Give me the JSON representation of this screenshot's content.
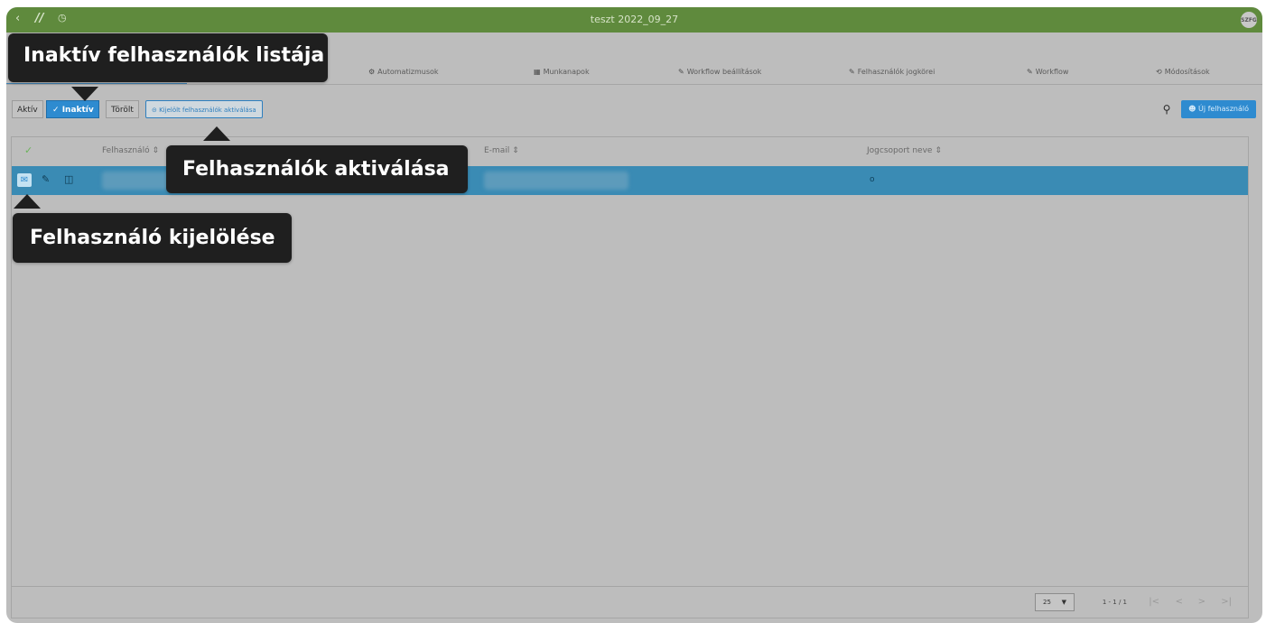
{
  "topbar": {
    "title": "teszt 2022_09_27",
    "avatar": "SZFG",
    "back_icon": "chevron-left-icon",
    "logo_icon": "app-logo-icon",
    "history_icon": "clock-icon"
  },
  "tabs": [
    {
      "label": "Automatizmusok",
      "icon": "cog-icon"
    },
    {
      "label": "Munkanapok",
      "icon": "calendar-icon"
    },
    {
      "label": "Workflow beállítások",
      "icon": "pencil-icon"
    },
    {
      "label": "Felhasználók jogkörei",
      "icon": "pencil-icon"
    },
    {
      "label": "Workflow",
      "icon": "pencil-icon"
    },
    {
      "label": "Módosítások",
      "icon": "history-icon"
    }
  ],
  "filters": {
    "aktiv": "Aktív",
    "inaktiv": "Inaktív",
    "torolt": "Törölt",
    "activate_selected": "Kijelölt felhasználók aktiválása"
  },
  "toolbar": {
    "new_user": "Új felhasználó"
  },
  "table": {
    "headers": [
      "Felhasználó",
      "E-mail",
      "Jogcsoport neve"
    ],
    "rows": [
      {
        "jogcsoport": "o"
      }
    ]
  },
  "footer": {
    "page_size": "25",
    "page_info": "1 - 1 / 1"
  },
  "callouts": {
    "inactive_list": "Inaktív felhasználók listája",
    "activate_users": "Felhasználók aktiválása",
    "select_user": "Felhasználó kijelölése"
  },
  "colors": {
    "topbar": "#5f8a3d",
    "accent": "#2e8bd0",
    "selected_row": "#3a8bb4",
    "callout_bg": "#1f1f1f"
  }
}
